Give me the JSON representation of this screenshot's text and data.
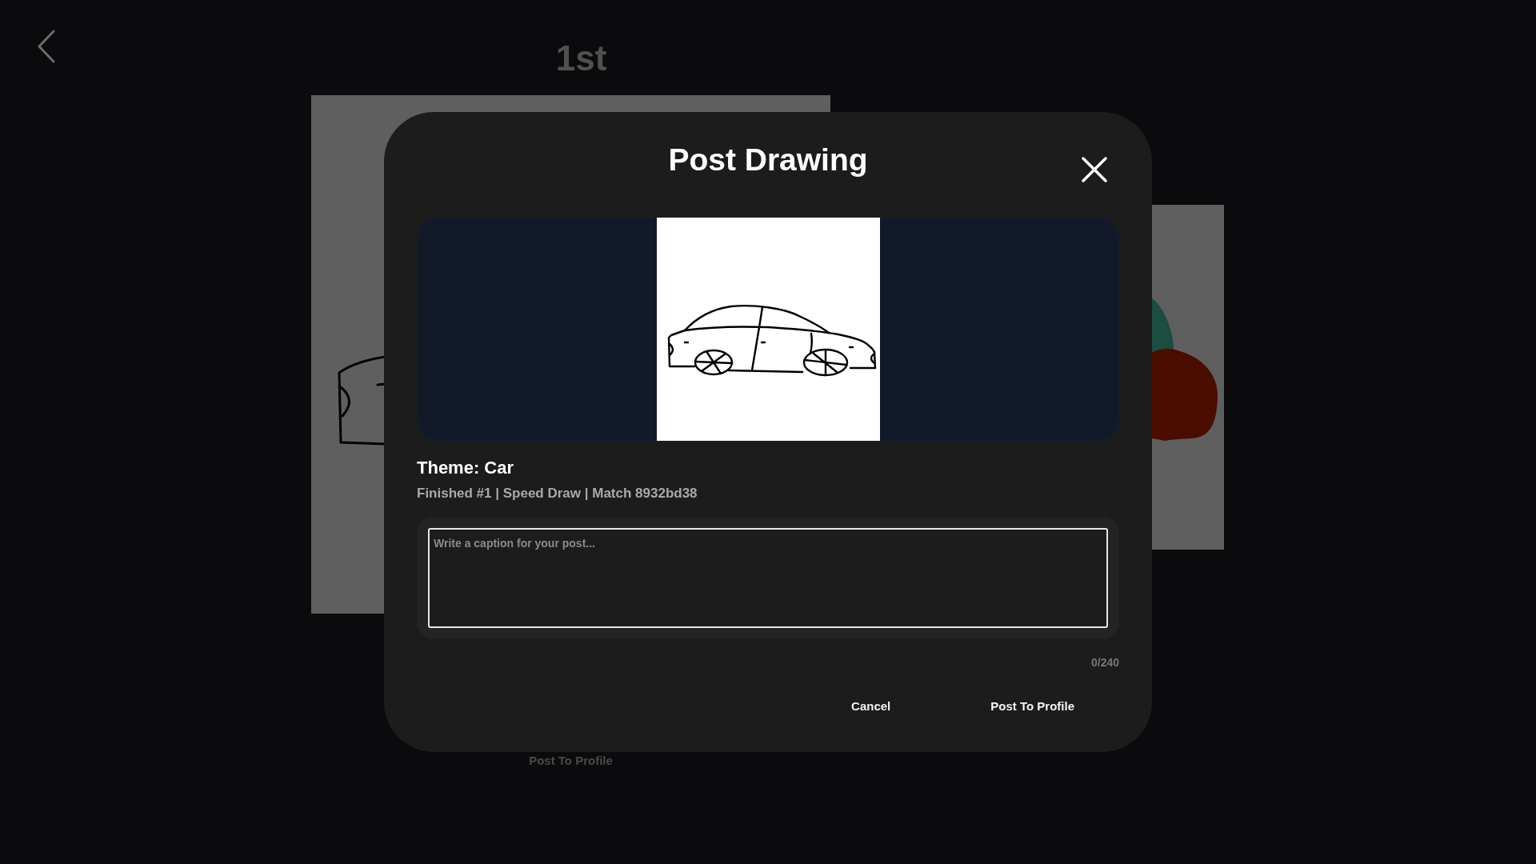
{
  "background": {
    "title": "1st",
    "post_button": "Post To Profile"
  },
  "dialog": {
    "title": "Post Drawing",
    "theme": "Theme: Car",
    "details": "Finished #1 | Speed Draw | Match 8932bd38",
    "caption": {
      "placeholder": "Write a caption for your post..."
    },
    "counter": "0/240",
    "buttons": [
      "Cancel",
      "Post To Profile"
    ]
  }
}
